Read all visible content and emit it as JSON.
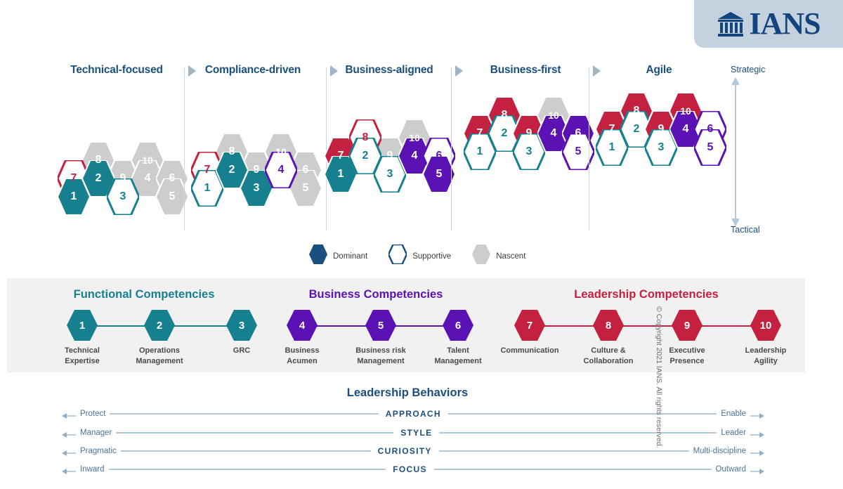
{
  "brand": {
    "logo_text": "IANS",
    "logo_icon": "classical-building-icon",
    "panel_color": "#c3d2de",
    "navy": "#13447e"
  },
  "colors": {
    "teal": "#16808f",
    "purple": "#5b12b5",
    "red": "#c4203f",
    "gray": "#cdcdcd",
    "navy": "#1b4f7e",
    "band_bg": "#f1f1f1",
    "rule": "#b3c9da"
  },
  "maturity_axis": {
    "top_label": "Strategic",
    "bottom_label": "Tactical"
  },
  "stages": [
    {
      "label": "Technical-focused",
      "hexes": [
        {
          "n": "7",
          "color": "red",
          "style": "outline",
          "col": 0,
          "row": 1
        },
        {
          "n": "1",
          "color": "teal",
          "style": "filled",
          "col": 0,
          "row": 2
        },
        {
          "n": "8",
          "color": "gray",
          "style": "filled",
          "col": 1,
          "row": 0
        },
        {
          "n": "2",
          "color": "teal",
          "style": "filled",
          "col": 1,
          "row": 1
        },
        {
          "n": "9",
          "color": "gray",
          "style": "filled",
          "col": 2,
          "row": 1
        },
        {
          "n": "3",
          "color": "teal",
          "style": "outline",
          "col": 2,
          "row": 2
        },
        {
          "n": "10",
          "color": "gray",
          "style": "filled",
          "col": 3,
          "row": 0
        },
        {
          "n": "4",
          "color": "gray",
          "style": "filled",
          "col": 3,
          "row": 1
        },
        {
          "n": "6",
          "color": "gray",
          "style": "filled",
          "col": 4,
          "row": 1
        },
        {
          "n": "5",
          "color": "gray",
          "style": "filled",
          "col": 4,
          "row": 2
        }
      ]
    },
    {
      "label": "Compliance-driven",
      "hexes": [
        {
          "n": "7",
          "color": "red",
          "style": "outline",
          "col": 0,
          "row": 1
        },
        {
          "n": "1",
          "color": "teal",
          "style": "outline",
          "col": 0,
          "row": 2
        },
        {
          "n": "8",
          "color": "gray",
          "style": "filled",
          "col": 1,
          "row": 0
        },
        {
          "n": "2",
          "color": "teal",
          "style": "filled",
          "col": 1,
          "row": 1
        },
        {
          "n": "9",
          "color": "gray",
          "style": "filled",
          "col": 2,
          "row": 1
        },
        {
          "n": "3",
          "color": "teal",
          "style": "filled",
          "col": 2,
          "row": 2
        },
        {
          "n": "10",
          "color": "gray",
          "style": "filled",
          "col": 3,
          "row": 0
        },
        {
          "n": "4",
          "color": "purple",
          "style": "outline",
          "col": 3,
          "row": 1
        },
        {
          "n": "6",
          "color": "gray",
          "style": "filled",
          "col": 4,
          "row": 1
        },
        {
          "n": "5",
          "color": "gray",
          "style": "filled",
          "col": 4,
          "row": 2
        }
      ]
    },
    {
      "label": "Business-aligned",
      "hexes": [
        {
          "n": "7",
          "color": "red",
          "style": "filled",
          "col": 0,
          "row": 1
        },
        {
          "n": "1",
          "color": "teal",
          "style": "filled",
          "col": 0,
          "row": 2
        },
        {
          "n": "8",
          "color": "red",
          "style": "outline",
          "col": 1,
          "row": 0
        },
        {
          "n": "2",
          "color": "teal",
          "style": "outline",
          "col": 1,
          "row": 1
        },
        {
          "n": "9",
          "color": "gray",
          "style": "filled",
          "col": 2,
          "row": 1
        },
        {
          "n": "3",
          "color": "teal",
          "style": "outline",
          "col": 2,
          "row": 2
        },
        {
          "n": "10",
          "color": "gray",
          "style": "filled",
          "col": 3,
          "row": 0
        },
        {
          "n": "4",
          "color": "purple",
          "style": "filled",
          "col": 3,
          "row": 1
        },
        {
          "n": "6",
          "color": "purple",
          "style": "outline",
          "col": 4,
          "row": 1
        },
        {
          "n": "5",
          "color": "purple",
          "style": "filled",
          "col": 4,
          "row": 2
        }
      ]
    },
    {
      "label": "Business-first",
      "hexes": [
        {
          "n": "7",
          "color": "red",
          "style": "filled",
          "col": 0,
          "row": 1
        },
        {
          "n": "1",
          "color": "teal",
          "style": "outline",
          "col": 0,
          "row": 2
        },
        {
          "n": "8",
          "color": "red",
          "style": "filled",
          "col": 1,
          "row": 0
        },
        {
          "n": "2",
          "color": "teal",
          "style": "outline",
          "col": 1,
          "row": 1
        },
        {
          "n": "9",
          "color": "red",
          "style": "filled",
          "col": 2,
          "row": 1
        },
        {
          "n": "3",
          "color": "teal",
          "style": "outline",
          "col": 2,
          "row": 2
        },
        {
          "n": "10",
          "color": "gray",
          "style": "filled",
          "col": 3,
          "row": 0
        },
        {
          "n": "4",
          "color": "purple",
          "style": "filled",
          "col": 3,
          "row": 1
        },
        {
          "n": "6",
          "color": "purple",
          "style": "filled",
          "col": 4,
          "row": 1
        },
        {
          "n": "5",
          "color": "purple",
          "style": "outline",
          "col": 4,
          "row": 2
        }
      ]
    },
    {
      "label": "Agile",
      "hexes": [
        {
          "n": "7",
          "color": "red",
          "style": "filled",
          "col": 0,
          "row": 1
        },
        {
          "n": "1",
          "color": "teal",
          "style": "outline",
          "col": 0,
          "row": 2
        },
        {
          "n": "8",
          "color": "red",
          "style": "filled",
          "col": 1,
          "row": 0
        },
        {
          "n": "2",
          "color": "teal",
          "style": "outline",
          "col": 1,
          "row": 1
        },
        {
          "n": "9",
          "color": "red",
          "style": "filled",
          "col": 2,
          "row": 1
        },
        {
          "n": "3",
          "color": "teal",
          "style": "outline",
          "col": 2,
          "row": 2
        },
        {
          "n": "10",
          "color": "red",
          "style": "filled",
          "col": 3,
          "row": 0
        },
        {
          "n": "4",
          "color": "purple",
          "style": "filled",
          "col": 3,
          "row": 1
        },
        {
          "n": "6",
          "color": "purple",
          "style": "outline",
          "col": 4,
          "row": 1
        },
        {
          "n": "5",
          "color": "purple",
          "style": "outline",
          "col": 4,
          "row": 2
        }
      ]
    }
  ],
  "legend": [
    {
      "label": "Dominant",
      "style": "filled",
      "color": "#1b4f7e"
    },
    {
      "label": "Supportive",
      "style": "outline",
      "color": "#1b4f7e"
    },
    {
      "label": "Nascent",
      "style": "filled",
      "color": "#cdcdcd"
    }
  ],
  "competency_groups": [
    {
      "title": "Functional Competencies",
      "color": "#16808f",
      "items": [
        {
          "n": "1",
          "caption": "Technical\nExpertise"
        },
        {
          "n": "2",
          "caption": "Operations\nManagement"
        },
        {
          "n": "3",
          "caption": "GRC"
        }
      ]
    },
    {
      "title": "Business Competencies",
      "color": "#5b12b5",
      "items": [
        {
          "n": "4",
          "caption": "Business\nAcumen"
        },
        {
          "n": "5",
          "caption": "Business risk\nManagement"
        },
        {
          "n": "6",
          "caption": "Talent\nManagement"
        }
      ]
    },
    {
      "title": "Leadership Competencies",
      "color": "#c4203f",
      "items": [
        {
          "n": "7",
          "caption": "Communication"
        },
        {
          "n": "8",
          "caption": "Culture &\nCollaboration"
        },
        {
          "n": "9",
          "caption": "Executive\nPresence"
        },
        {
          "n": "10",
          "caption": "Leadership\nAgility"
        }
      ]
    }
  ],
  "leadership_behaviors": {
    "title": "Leadership Behaviors",
    "rows": [
      {
        "left": "Protect",
        "center": "APPROACH",
        "right": "Enable"
      },
      {
        "left": "Manager",
        "center": "STYLE",
        "right": "Leader"
      },
      {
        "left": "Pragmatic",
        "center": "CURIOSITY",
        "right": "Multi-discipline"
      },
      {
        "left": "Inward",
        "center": "FOCUS",
        "right": "Outward"
      }
    ]
  },
  "footer": {
    "copyright": "© Copyright 2021 IANS. All rights reserved."
  }
}
